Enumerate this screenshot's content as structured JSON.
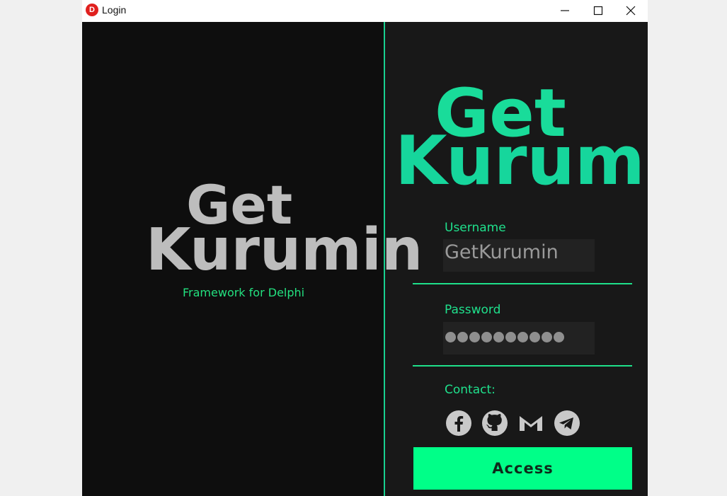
{
  "window": {
    "title": "Login",
    "app_icon_letter": "D"
  },
  "left_panel": {
    "logo_top": "Get",
    "logo_bottom": "Kurumin",
    "tagline": "Framework for Delphi"
  },
  "right_panel": {
    "logo_top": "Get",
    "logo_bottom": "Kurumin",
    "username_label": "Username",
    "username_value": "GetKurumin",
    "password_label": "Password",
    "password_masked_count": 10,
    "contact_label": "Contact:",
    "contacts": [
      {
        "icon": "facebook-icon"
      },
      {
        "icon": "github-icon"
      },
      {
        "icon": "gmail-icon"
      },
      {
        "icon": "telegram-icon"
      }
    ],
    "access_button": "Access"
  },
  "colors": {
    "accent": "#00ff88",
    "accent_text": "#1fe08c",
    "left_bg": "#0e0e0e",
    "right_bg": "#181818",
    "logo_grey": "#bdbdbd"
  }
}
